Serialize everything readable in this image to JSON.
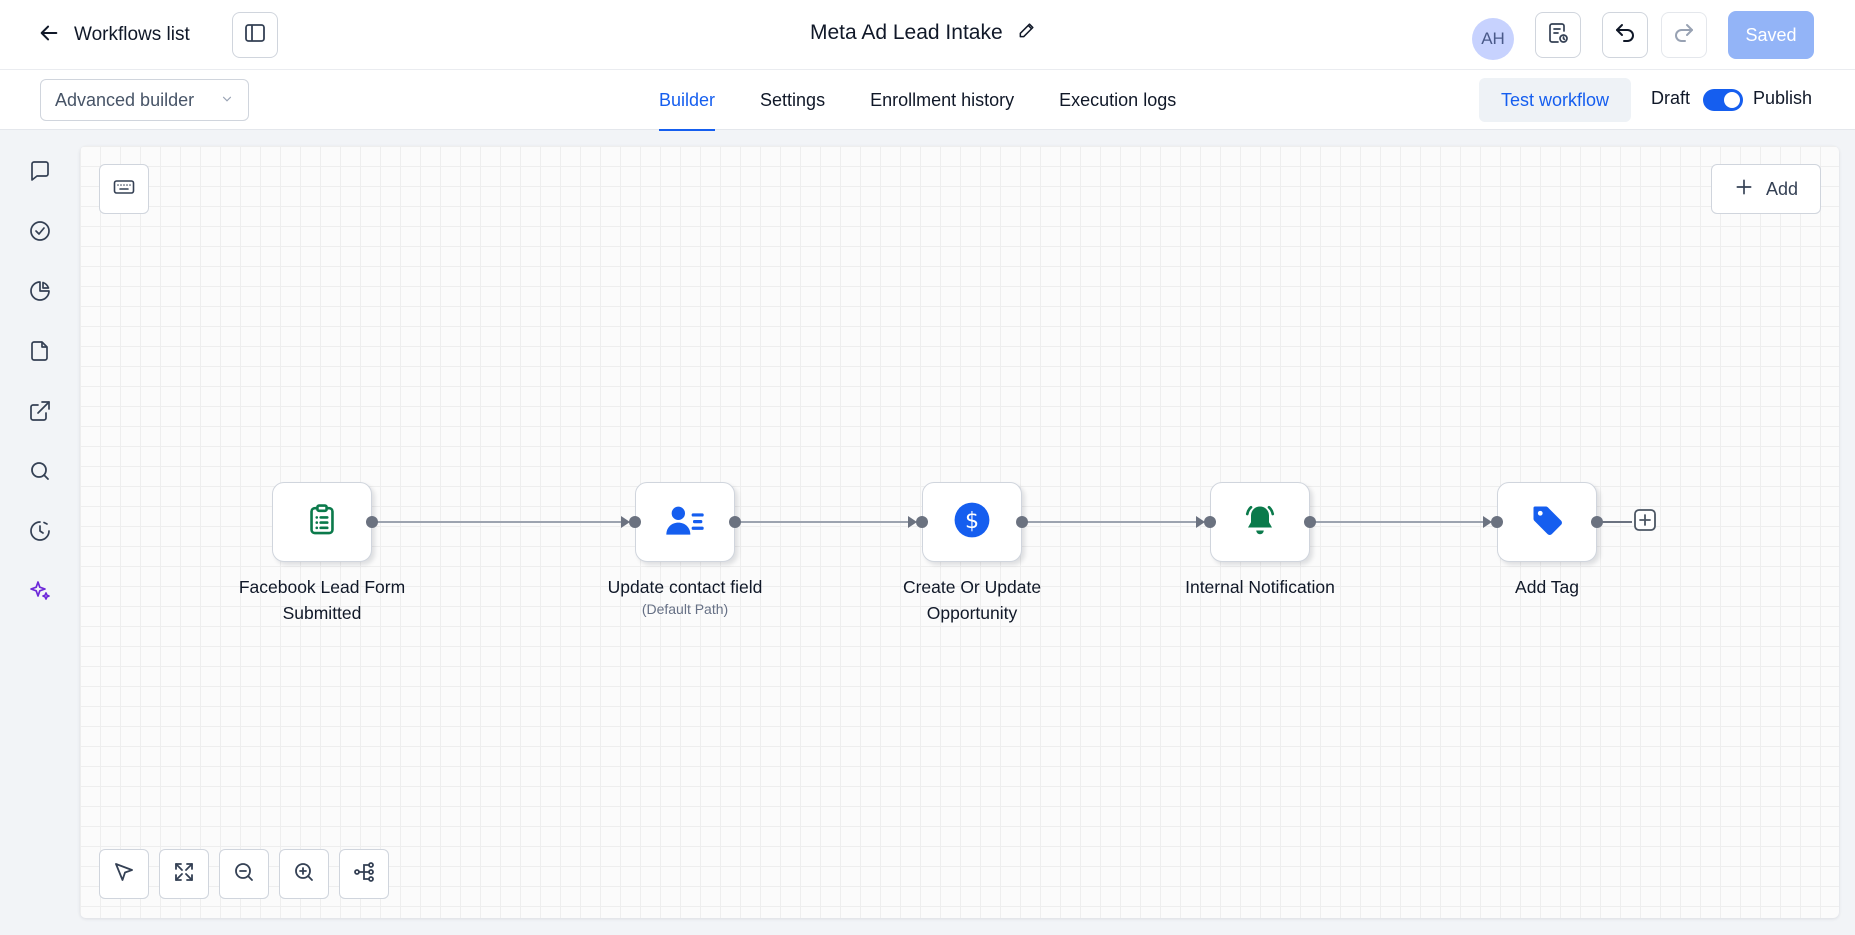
{
  "header": {
    "back_label": "Workflows list",
    "workflow_title": "Meta Ad Lead Intake",
    "avatar_initials": "AH",
    "saved_label": "Saved"
  },
  "subbar": {
    "builder_type": "Advanced builder",
    "tabs": [
      {
        "label": "Builder",
        "active": true
      },
      {
        "label": "Settings",
        "active": false
      },
      {
        "label": "Enrollment history",
        "active": false
      },
      {
        "label": "Execution logs",
        "active": false
      }
    ],
    "test_label": "Test workflow",
    "draft_label": "Draft",
    "publish_label": "Publish",
    "published": true
  },
  "sidebar": {
    "items": [
      "chat-icon",
      "check-circle-icon",
      "pie-chart-icon",
      "file-icon",
      "external-link-icon",
      "search-icon",
      "history-icon",
      "sparkles-icon"
    ]
  },
  "canvas": {
    "add_label": "Add",
    "nodes": [
      {
        "label": "Facebook Lead Form Submitted",
        "sub": "",
        "icon": "clipboard-icon",
        "color": "#0b7a4b"
      },
      {
        "label": "Update contact field",
        "sub": "(Default Path)",
        "icon": "contact-edit-icon",
        "color": "#155eef"
      },
      {
        "label": "Create Or Update Opportunity",
        "sub": "",
        "icon": "dollar-icon",
        "color": "#155eef"
      },
      {
        "label": "Internal Notification",
        "sub": "",
        "icon": "bell-ring-icon",
        "color": "#0b7a4b"
      },
      {
        "label": "Add Tag",
        "sub": "",
        "icon": "tag-icon",
        "color": "#155eef"
      }
    ]
  },
  "colors": {
    "accent": "#155eef",
    "saved_button": "#93b4f7",
    "connector": "#6b7280",
    "sidebar_active": "#6d28d9"
  }
}
